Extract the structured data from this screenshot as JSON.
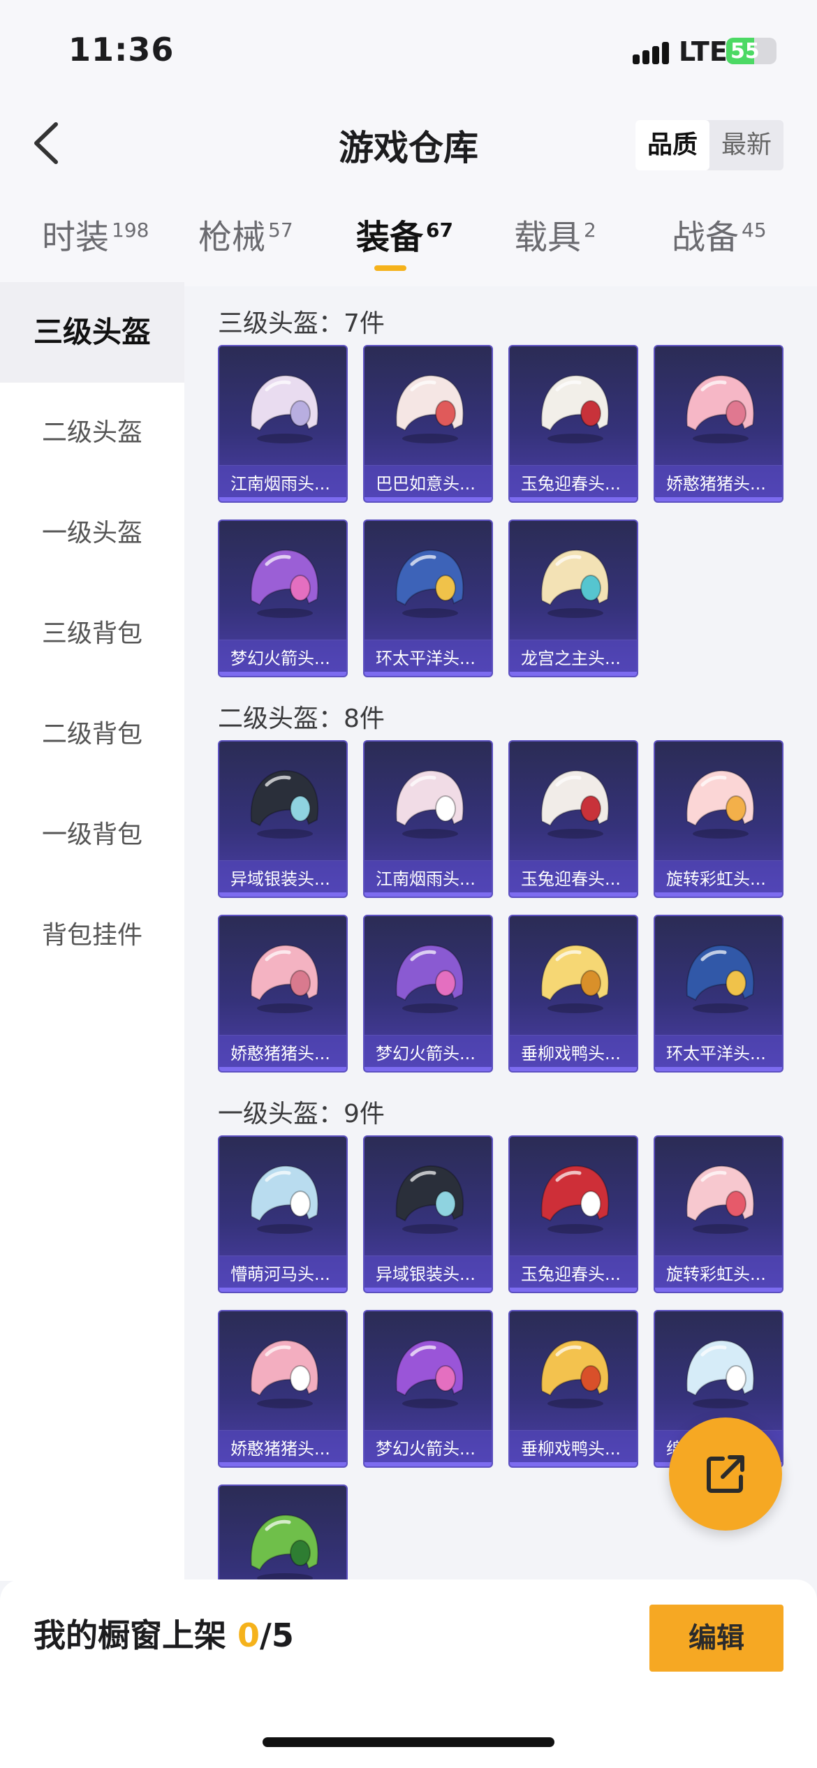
{
  "status_bar": {
    "time": "11:36",
    "network": "LTE",
    "battery": "55",
    "battery_level": 0.55
  },
  "header": {
    "title": "游戏仓库",
    "sort_options": [
      "品质",
      "最新"
    ],
    "sort_selected": "品质"
  },
  "tabs": [
    {
      "label": "时装",
      "count": "198"
    },
    {
      "label": "枪械",
      "count": "57"
    },
    {
      "label": "装备",
      "count": "67"
    },
    {
      "label": "载具",
      "count": "2"
    },
    {
      "label": "战备",
      "count": "45"
    }
  ],
  "active_tab": "装备",
  "sidebar": {
    "items": [
      "三级头盔",
      "二级头盔",
      "一级头盔",
      "三级背包",
      "二级背包",
      "一级背包",
      "背包挂件"
    ],
    "active": "三级头盔"
  },
  "sections": [
    {
      "title": "三级头盔：7件",
      "items": [
        {
          "label": "江南烟雨头...",
          "color": "#e9dcf0",
          "accent": "#b8aee0"
        },
        {
          "label": "巴巴如意头...",
          "color": "#f5e6e4",
          "accent": "#e05a5a"
        },
        {
          "label": "玉兔迎春头...",
          "color": "#f2efe9",
          "accent": "#c8323a"
        },
        {
          "label": "娇憨猪猪头...",
          "color": "#f6b7c6",
          "accent": "#e07890"
        },
        {
          "label": "梦幻火箭头...",
          "color": "#9b5fd6",
          "accent": "#e46fc0"
        },
        {
          "label": "环太平洋头...",
          "color": "#3d63b8",
          "accent": "#f0c24a"
        },
        {
          "label": "龙宫之主头...",
          "color": "#f3e2b5",
          "accent": "#56c5cf"
        }
      ]
    },
    {
      "title": "二级头盔：8件",
      "items": [
        {
          "label": "异域银装头...",
          "color": "#2a2f3a",
          "accent": "#8fd3e0"
        },
        {
          "label": "江南烟雨头...",
          "color": "#f1dce6",
          "accent": "#ffffff"
        },
        {
          "label": "玉兔迎春头...",
          "color": "#f1ece8",
          "accent": "#c8323a"
        },
        {
          "label": "旋转彩虹头...",
          "color": "#fbd6d6",
          "accent": "#f3b04a"
        },
        {
          "label": "娇憨猪猪头...",
          "color": "#f4b3c2",
          "accent": "#d97a8e"
        },
        {
          "label": "梦幻火箭头...",
          "color": "#8a5ad2",
          "accent": "#e46fc0"
        },
        {
          "label": "垂柳戏鸭头...",
          "color": "#f6d774",
          "accent": "#d9902a"
        },
        {
          "label": "环太平洋头...",
          "color": "#3158a8",
          "accent": "#f0c24a"
        }
      ]
    },
    {
      "title": "一级头盔：9件",
      "items": [
        {
          "label": "懵萌河马头...",
          "color": "#b9dcef",
          "accent": "#ffffff"
        },
        {
          "label": "异域银装头...",
          "color": "#2a2f3a",
          "accent": "#8fd3e0"
        },
        {
          "label": "玉兔迎春头...",
          "color": "#ce2f38",
          "accent": "#ffffff"
        },
        {
          "label": "旋转彩虹头...",
          "color": "#f7c8cf",
          "accent": "#e65a6a"
        },
        {
          "label": "娇憨猪猪头...",
          "color": "#f3aec0",
          "accent": "#ffffff"
        },
        {
          "label": "梦幻火箭头...",
          "color": "#9a55d8",
          "accent": "#e46fc0"
        },
        {
          "label": "垂柳戏鸭头...",
          "color": "#f3c24e",
          "accent": "#d9502a"
        },
        {
          "label": "绵...",
          "color": "#d6ecf8",
          "accent": "#ffffff"
        },
        {
          "label": "",
          "color": "#6fbf4a",
          "accent": "#2e7d32"
        }
      ]
    }
  ],
  "bottom_bar": {
    "showcase_prefix": "我的橱窗上架 ",
    "showcase_count": "0",
    "showcase_total": "/5",
    "edit_label": "编辑"
  },
  "colors": {
    "accent": "#f6a823",
    "card_bg": "#35327a"
  },
  "icons": {
    "back": "chevron-left-icon",
    "share": "external-link-icon",
    "helmet": "helmet-icon"
  }
}
